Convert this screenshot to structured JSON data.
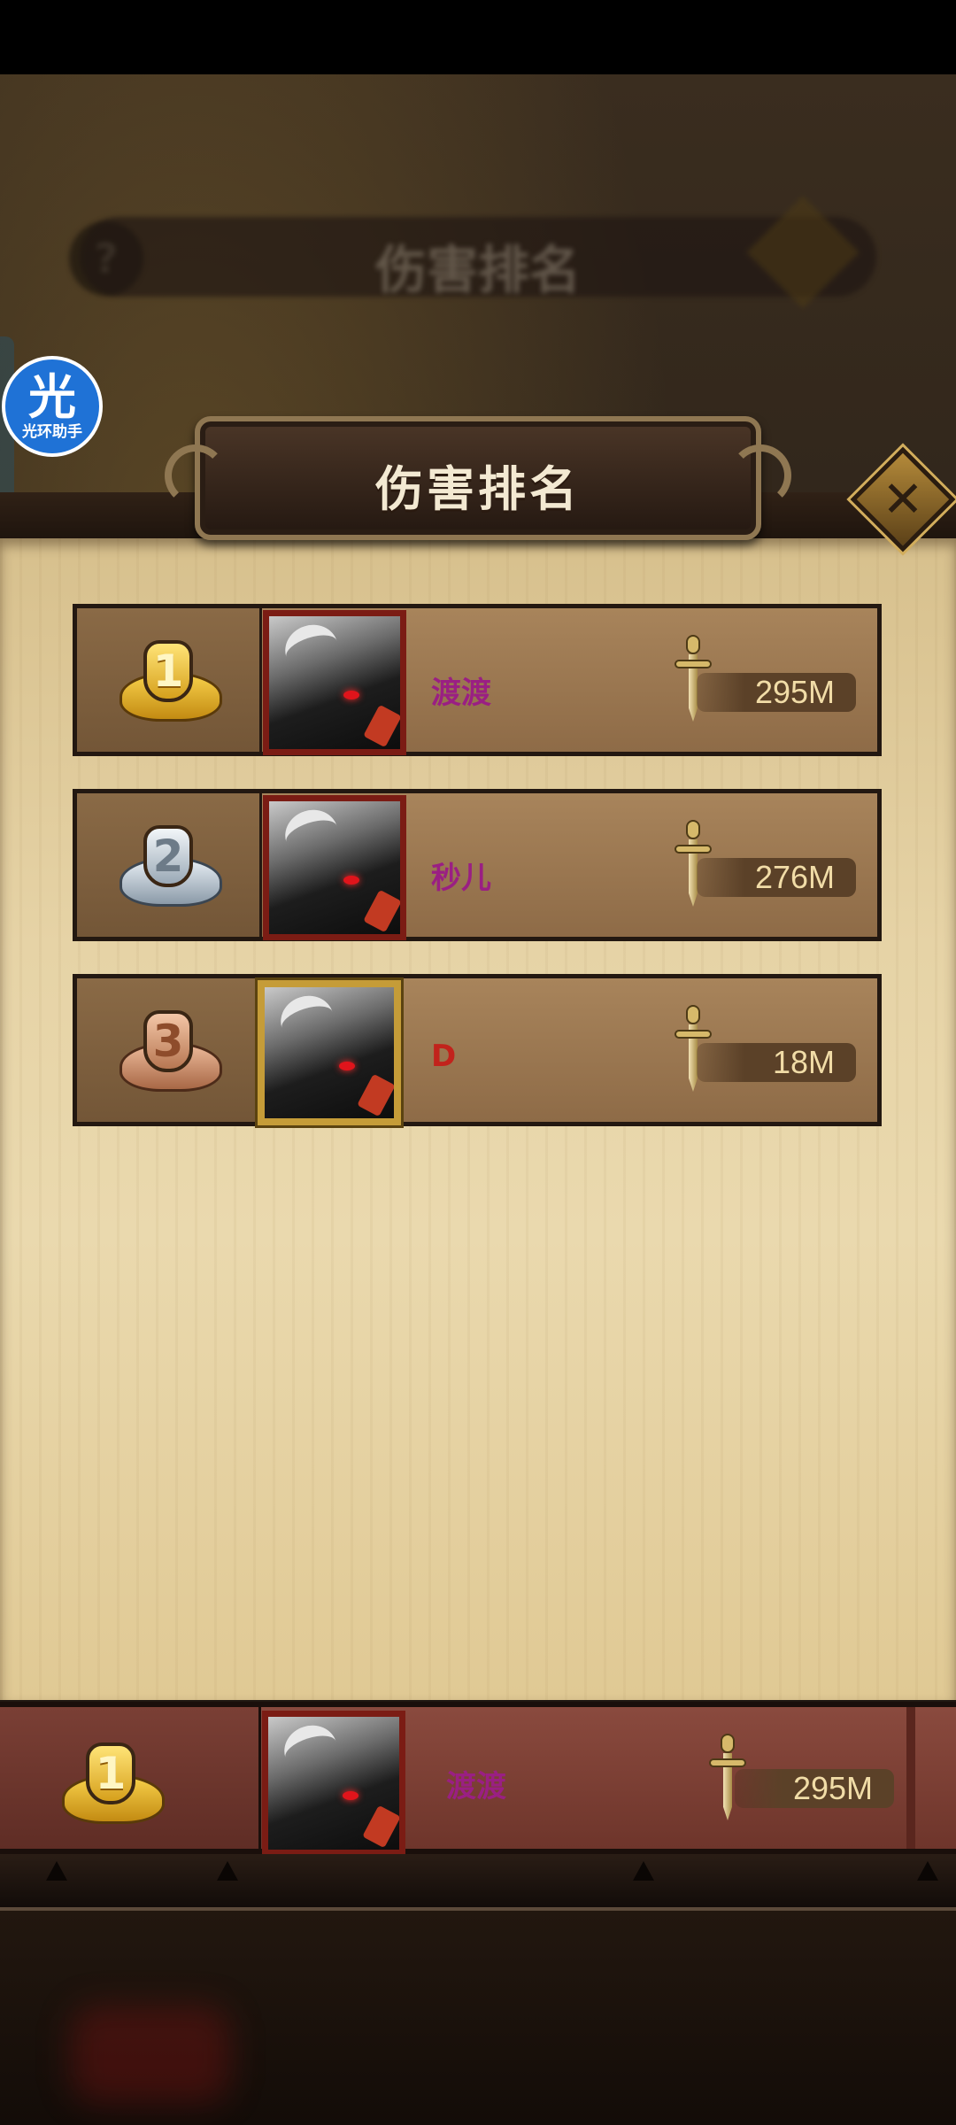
{
  "background": {
    "title": "伤害排名",
    "subtitle": "",
    "help_label": "?"
  },
  "assistant": {
    "glyph": "光",
    "label": "光环助手"
  },
  "dialog": {
    "title": "伤害排名",
    "close_label": "✕"
  },
  "rankings": [
    {
      "rank": "1",
      "medal": "gold",
      "name": "渡渡",
      "damage": "295M",
      "avatar_frame": "red"
    },
    {
      "rank": "2",
      "medal": "silver",
      "name": "秒儿",
      "damage": "276M",
      "avatar_frame": "red"
    },
    {
      "rank": "3",
      "medal": "bronze",
      "name": "D",
      "damage": "18M",
      "avatar_frame": "gold"
    }
  ],
  "my_rank": {
    "rank": "1",
    "medal": "gold",
    "name": "渡渡",
    "damage": "295M"
  },
  "icons": {
    "damage": "sword-icon",
    "close": "close-icon",
    "medal": "medal-icon"
  }
}
